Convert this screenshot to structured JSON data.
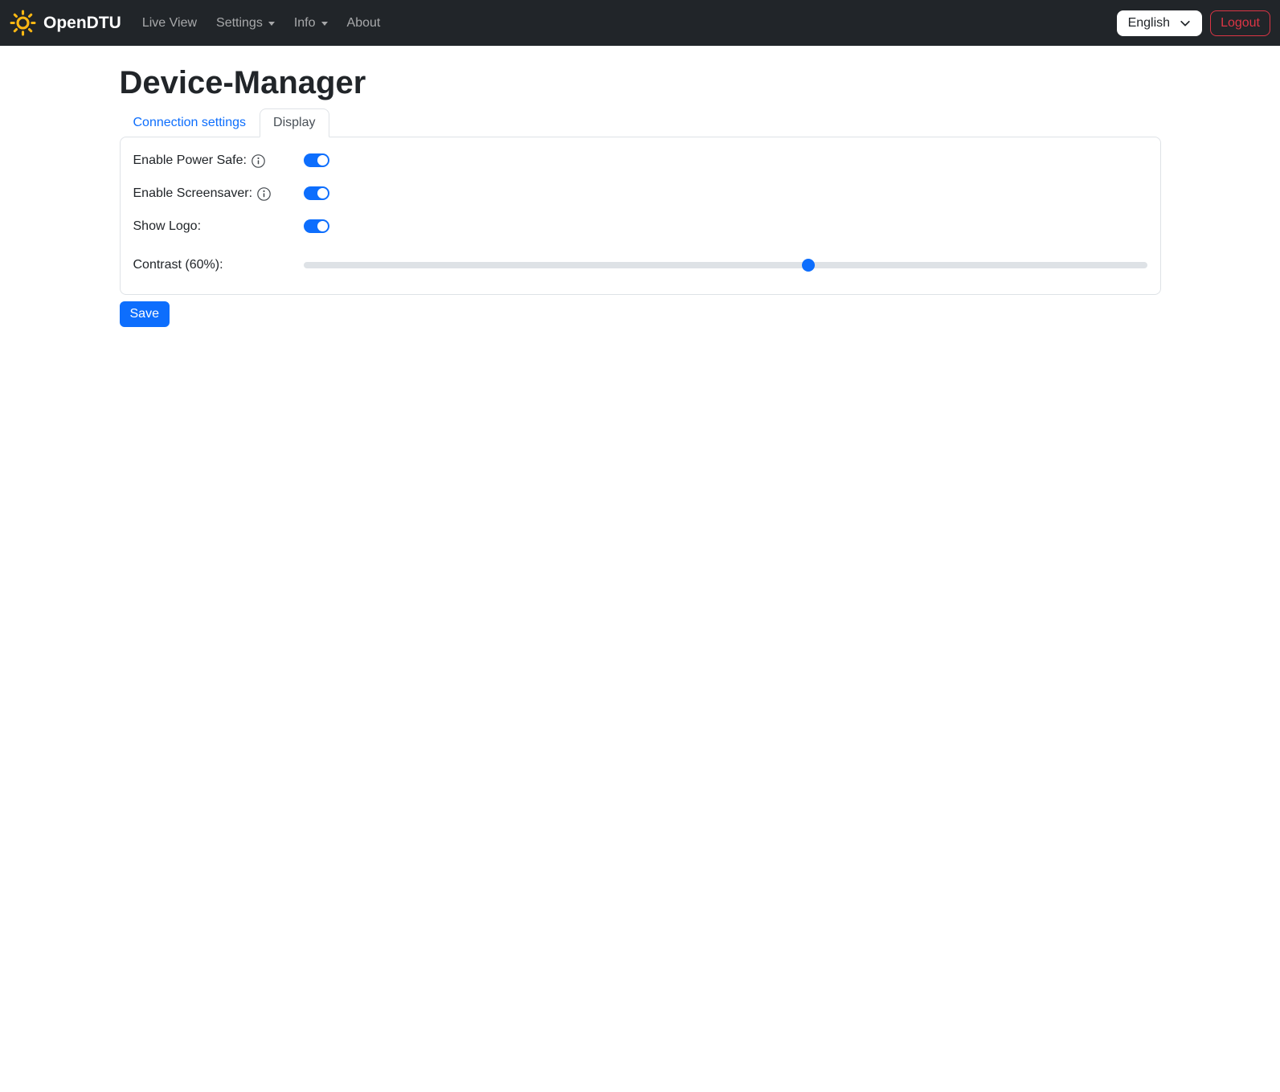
{
  "colors": {
    "navbar_bg": "#212529",
    "accent_blue": "#0d6efd",
    "danger_red": "#dc3545",
    "border_gray": "#dee2e6",
    "brand_gold": "#fdb813"
  },
  "navbar": {
    "brand": "OpenDTU",
    "brand_icon": "sun-icon",
    "items": [
      {
        "label": "Live View",
        "has_dropdown": false
      },
      {
        "label": "Settings",
        "has_dropdown": true
      },
      {
        "label": "Info",
        "has_dropdown": true
      },
      {
        "label": "About",
        "has_dropdown": false
      }
    ],
    "language_selector": {
      "value": "English",
      "icon": "chevron-down-icon"
    },
    "logout_label": "Logout"
  },
  "page": {
    "title": "Device-Manager"
  },
  "tabs": [
    {
      "label": "Connection settings",
      "active": false
    },
    {
      "label": "Display",
      "active": true
    }
  ],
  "form": {
    "rows": [
      {
        "label": "Enable Power Safe:",
        "info_icon": true,
        "type": "switch",
        "value": true
      },
      {
        "label": "Enable Screensaver:",
        "info_icon": true,
        "type": "switch",
        "value": true
      },
      {
        "label": "Show Logo:",
        "info_icon": false,
        "type": "switch",
        "value": true
      },
      {
        "label": "Contrast (60%):",
        "info_icon": false,
        "type": "slider",
        "value": 60,
        "min": 0,
        "max": 100
      }
    ],
    "save_label": "Save"
  }
}
